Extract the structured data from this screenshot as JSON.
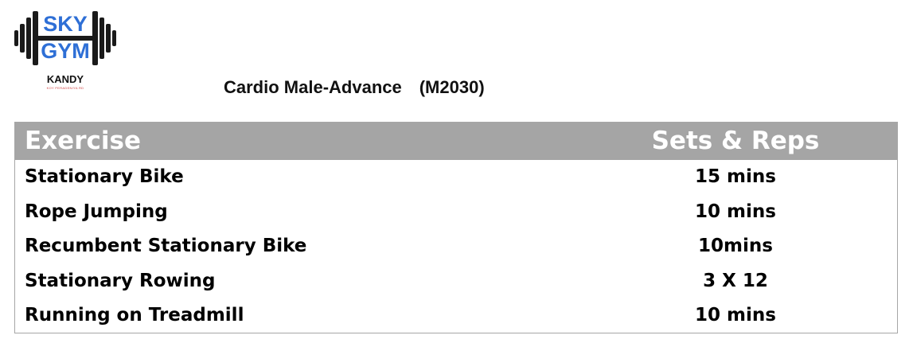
{
  "logo": {
    "line1": "SKY",
    "line2": "GYM",
    "location": "KANDY",
    "tagline": "KOY PERADENIYA RD"
  },
  "title": {
    "name": "Cardio Male-Advance",
    "code": "(M2030)"
  },
  "table": {
    "headers": [
      "Exercise",
      "Sets & Reps"
    ],
    "rows": [
      [
        "Stationary Bike",
        "15 mins"
      ],
      [
        "Rope Jumping",
        "10 mins"
      ],
      [
        "Recumbent Stationary Bike",
        "10mins"
      ],
      [
        "Stationary Rowing",
        "3 X 12"
      ],
      [
        "Running on Treadmill",
        "10 mins"
      ]
    ]
  },
  "colors": {
    "header_bg": "#a5a5a5",
    "logo_blue": "#2e6fd6",
    "logo_dark": "#1a1a1a"
  }
}
